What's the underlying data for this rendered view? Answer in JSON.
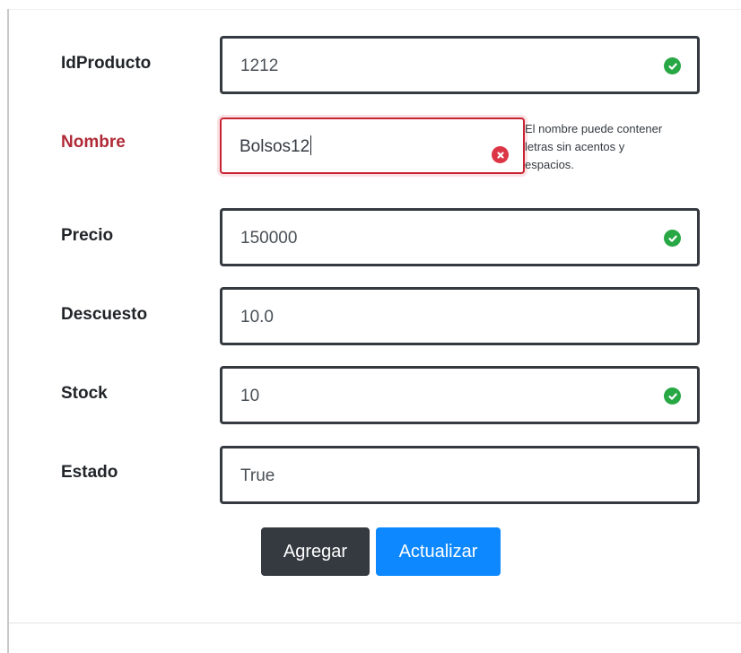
{
  "form": {
    "fields": [
      {
        "label": "IdProducto",
        "value": "1212",
        "status": "valid"
      },
      {
        "label": "Nombre",
        "value": "Bolsos12",
        "status": "invalid",
        "help_text": "El nombre puede contener letras sin acentos y espacios."
      },
      {
        "label": "Precio",
        "value": "150000",
        "status": "valid"
      },
      {
        "label": "Descuesto",
        "value": "10.0",
        "status": "none"
      },
      {
        "label": "Stock",
        "value": "10",
        "status": "valid"
      },
      {
        "label": "Estado",
        "value": "True",
        "status": "none"
      }
    ],
    "buttons": {
      "add_label": "Agregar",
      "update_label": "Actualizar"
    },
    "icons": {
      "valid": "check-circle-icon",
      "invalid": "x-circle-icon"
    },
    "colors": {
      "valid": "#28a745",
      "invalid": "#dc3545",
      "primary": "#0d88ff",
      "dark": "#343a40"
    }
  }
}
